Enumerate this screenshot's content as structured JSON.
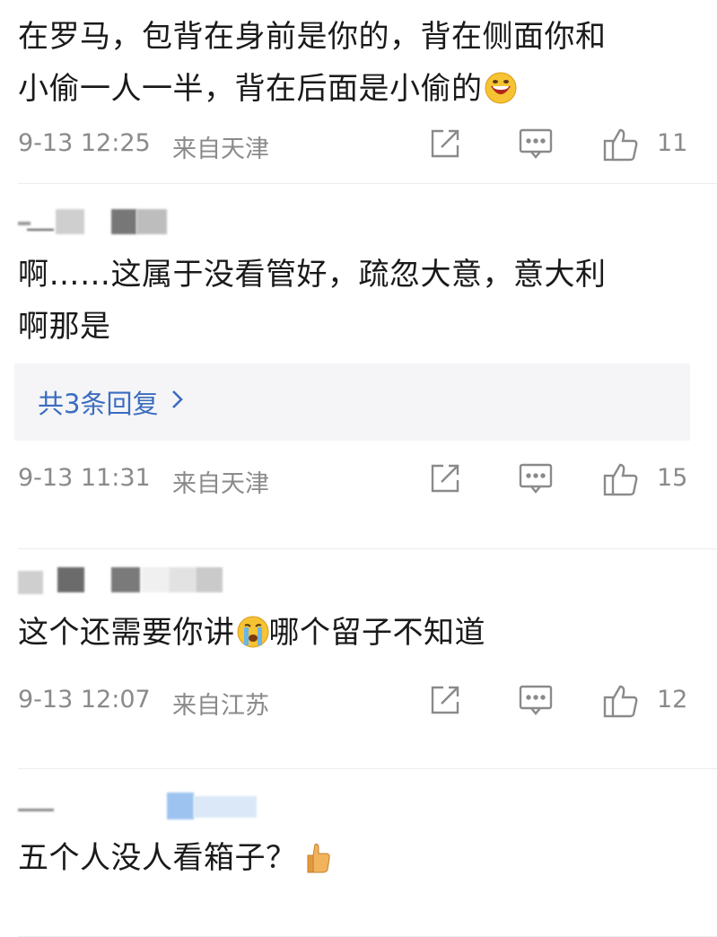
{
  "comments": [
    {
      "text": "在罗马，包背在身前是你的，背在侧面你和小偷一人一半，背在后面是小偷的",
      "line1": "在罗马，包背在身前是你的，背在侧面你和",
      "line2": "小偷一人一半，背在后面是小偷的",
      "emoji": "grinning-face",
      "date": "9-13 12:25",
      "location": "来自天津",
      "likes": "11"
    },
    {
      "line1": "啊……这属于没看管好，疏忽大意，意大利",
      "line2": "啊那是",
      "replies_label": "共3条回复",
      "date": "9-13 11:31",
      "location": "来自天津",
      "likes": "15"
    },
    {
      "text_before": "这个还需要你讲",
      "emoji": "crying-face",
      "text_after": "哪个留子不知道",
      "date": "9-13 12:07",
      "location": "来自江苏",
      "likes": "12"
    },
    {
      "text": "五个人没人看箱子？",
      "emoji": "thumbs-up"
    }
  ],
  "icons": [
    "share-icon",
    "comment-icon",
    "thumbs-up-icon"
  ],
  "colors": {
    "meta": "#8a8a8a",
    "link": "#3a6cc0",
    "reply_bg": "#f5f5f7"
  }
}
